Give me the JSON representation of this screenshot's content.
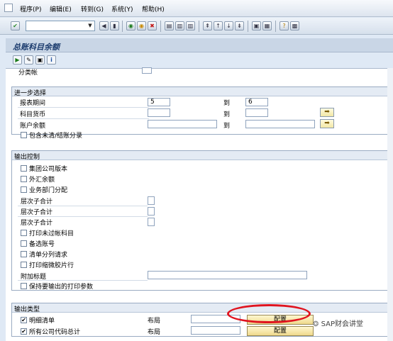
{
  "menu": {
    "items": [
      "程序(P)",
      "编辑(E)",
      "转到(G)",
      "系统(Y)",
      "帮助(H)"
    ]
  },
  "title": "总账科目余额",
  "sections": {
    "partial_label": "分类帐",
    "further_selection": {
      "title": "进一步选择",
      "to_label": "到",
      "rows": [
        {
          "label": "报表期间",
          "from": "5",
          "to": "6"
        },
        {
          "label": "科目货币",
          "from": "",
          "to": ""
        },
        {
          "label": "账户余额",
          "from": "",
          "to": ""
        }
      ],
      "checkbox": "包含未清/结账分录"
    },
    "output_control": {
      "title": "输出控制",
      "items": [
        "集团公司版本",
        "外汇余额",
        "业务部门分配"
      ],
      "levels": [
        "层次子合计",
        "层次子合计",
        "层次子合计"
      ],
      "items2": [
        "打印未过帐科目",
        "备选账号",
        "清单分列请求",
        "打印缩微胶片行"
      ],
      "extra_title": "附加标题",
      "keep_params": "保持要输出的打印参数"
    },
    "output_type": {
      "title": "输出类型",
      "rows": [
        {
          "label": "明细清单",
          "layout_label": "布局",
          "button": "配置",
          "checked": "✔"
        },
        {
          "label": "所有公司代码总计",
          "layout_label": "布局",
          "button": "配置",
          "checked": "✔"
        }
      ]
    }
  },
  "watermark": "SAP财会讲堂"
}
